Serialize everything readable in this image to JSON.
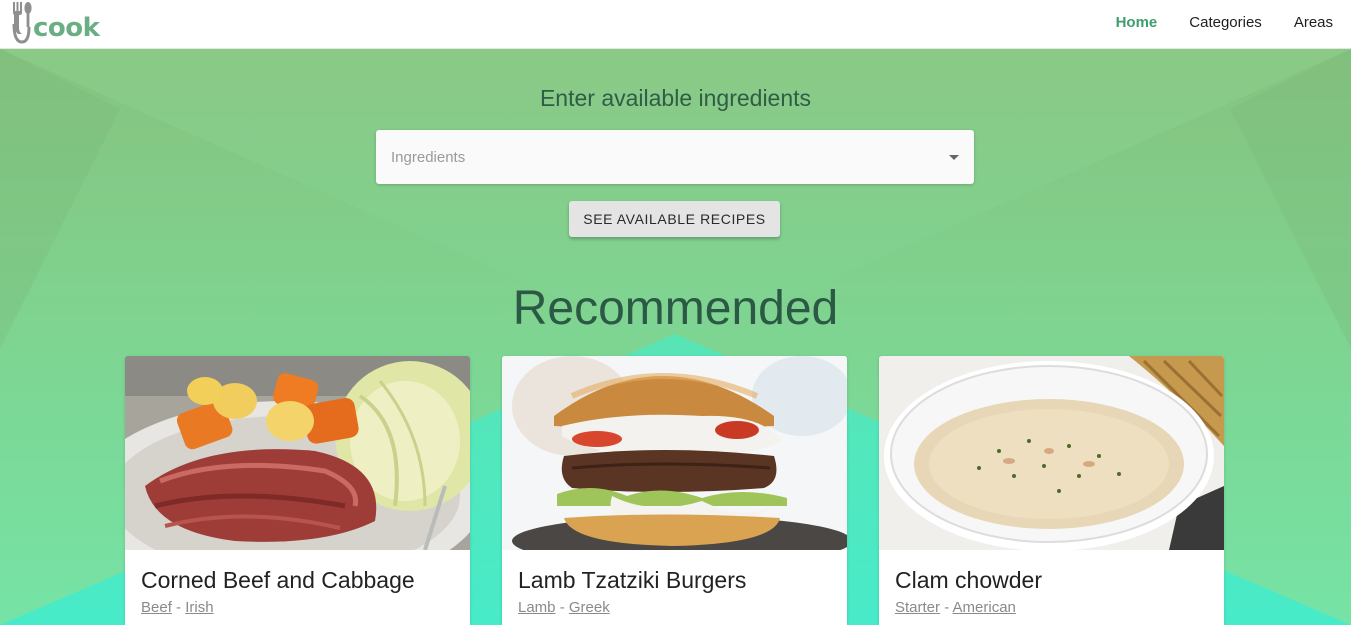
{
  "header": {
    "logo_text": "cook",
    "logo_brand_color": "#6cae84",
    "nav": [
      {
        "label": "Home",
        "active": true
      },
      {
        "label": "Categories",
        "active": false
      },
      {
        "label": "Areas",
        "active": false
      }
    ]
  },
  "hero": {
    "prompt": "Enter available ingredients",
    "ingredients_placeholder": "Ingredients",
    "ingredients_value": "",
    "see_button_label": "SEE AVAILABLE RECIPES",
    "recommended_heading": "Recommended"
  },
  "recipes": [
    {
      "title": "Corned Beef and Cabbage",
      "category": "Beef",
      "area": "Irish",
      "separator": "-"
    },
    {
      "title": "Lamb Tzatziki Burgers",
      "category": "Lamb",
      "area": "Greek",
      "separator": "-"
    },
    {
      "title": "Clam chowder",
      "category": "Starter",
      "area": "American",
      "separator": "-"
    }
  ],
  "colors": {
    "accent": "#3e9f6c",
    "hero_top": "#86c27f",
    "hero_bottom": "#75e3a6",
    "heading": "#2c5846"
  }
}
